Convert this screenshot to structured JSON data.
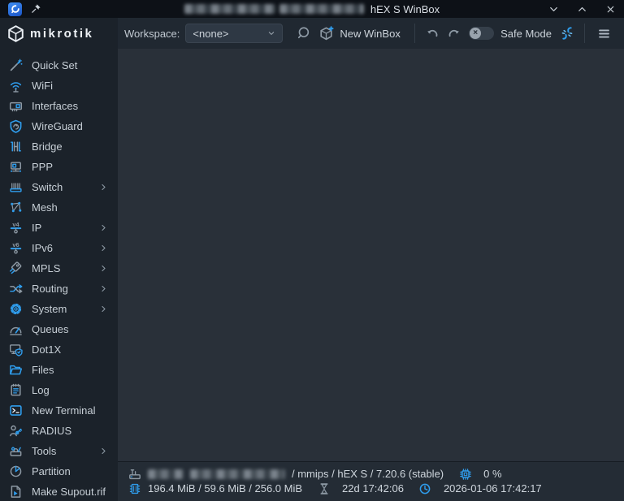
{
  "titlebar": {
    "title": "hEX S WinBox"
  },
  "brand": {
    "wordmark": "mikrotik"
  },
  "toolbar": {
    "workspace_label": "Workspace:",
    "workspace_value": "<none>",
    "new_winbox_label": "New WinBox",
    "safe_mode_label": "Safe Mode"
  },
  "sidebar": {
    "items": [
      {
        "label": "Quick Set",
        "icon": "wand-icon",
        "has_submenu": false
      },
      {
        "label": "WiFi",
        "icon": "wifi-icon",
        "has_submenu": false
      },
      {
        "label": "Interfaces",
        "icon": "interface-card-icon",
        "has_submenu": false
      },
      {
        "label": "WireGuard",
        "icon": "shield-icon",
        "has_submenu": false
      },
      {
        "label": "Bridge",
        "icon": "bridge-icon",
        "has_submenu": false
      },
      {
        "label": "PPP",
        "icon": "ppp-monitor-icon",
        "has_submenu": false
      },
      {
        "label": "Switch",
        "icon": "switch-icon",
        "has_submenu": true
      },
      {
        "label": "Mesh",
        "icon": "mesh-nodes-icon",
        "has_submenu": false
      },
      {
        "label": "IP",
        "icon": "ipv4-icon",
        "has_submenu": true
      },
      {
        "label": "IPv6",
        "icon": "ipv6-icon",
        "has_submenu": true
      },
      {
        "label": "MPLS",
        "icon": "label-tag-icon",
        "has_submenu": true
      },
      {
        "label": "Routing",
        "icon": "routing-arrows-icon",
        "has_submenu": true
      },
      {
        "label": "System",
        "icon": "gear-icon",
        "has_submenu": true
      },
      {
        "label": "Queues",
        "icon": "gauge-icon",
        "has_submenu": false
      },
      {
        "label": "Dot1X",
        "icon": "dot1x-shield-icon",
        "has_submenu": false
      },
      {
        "label": "Files",
        "icon": "folder-icon",
        "has_submenu": false
      },
      {
        "label": "Log",
        "icon": "log-notepad-icon",
        "has_submenu": false
      },
      {
        "label": "New Terminal",
        "icon": "terminal-icon",
        "has_submenu": false
      },
      {
        "label": "RADIUS",
        "icon": "user-key-icon",
        "has_submenu": false
      },
      {
        "label": "Tools",
        "icon": "toolbox-icon",
        "has_submenu": true
      },
      {
        "label": "Partition",
        "icon": "pie-chart-icon",
        "has_submenu": false
      },
      {
        "label": "Make Supout.rif",
        "icon": "supout-doc-icon",
        "has_submenu": false
      }
    ]
  },
  "statusbar": {
    "device_info": "/ mmips / hEX S / 7.20.6 (stable)",
    "cpu_load": "0 %",
    "memory": "196.4 MiB / 59.6 MiB / 256.0 MiB",
    "uptime": "22d 17:42:06",
    "datetime": "2026-01-06 17:42:17"
  },
  "colors": {
    "accent_blue": "#2f9ded",
    "spark_blue": "#6cc0f7",
    "icon_grey": "#8d99a4",
    "white": "#e9eef3"
  }
}
